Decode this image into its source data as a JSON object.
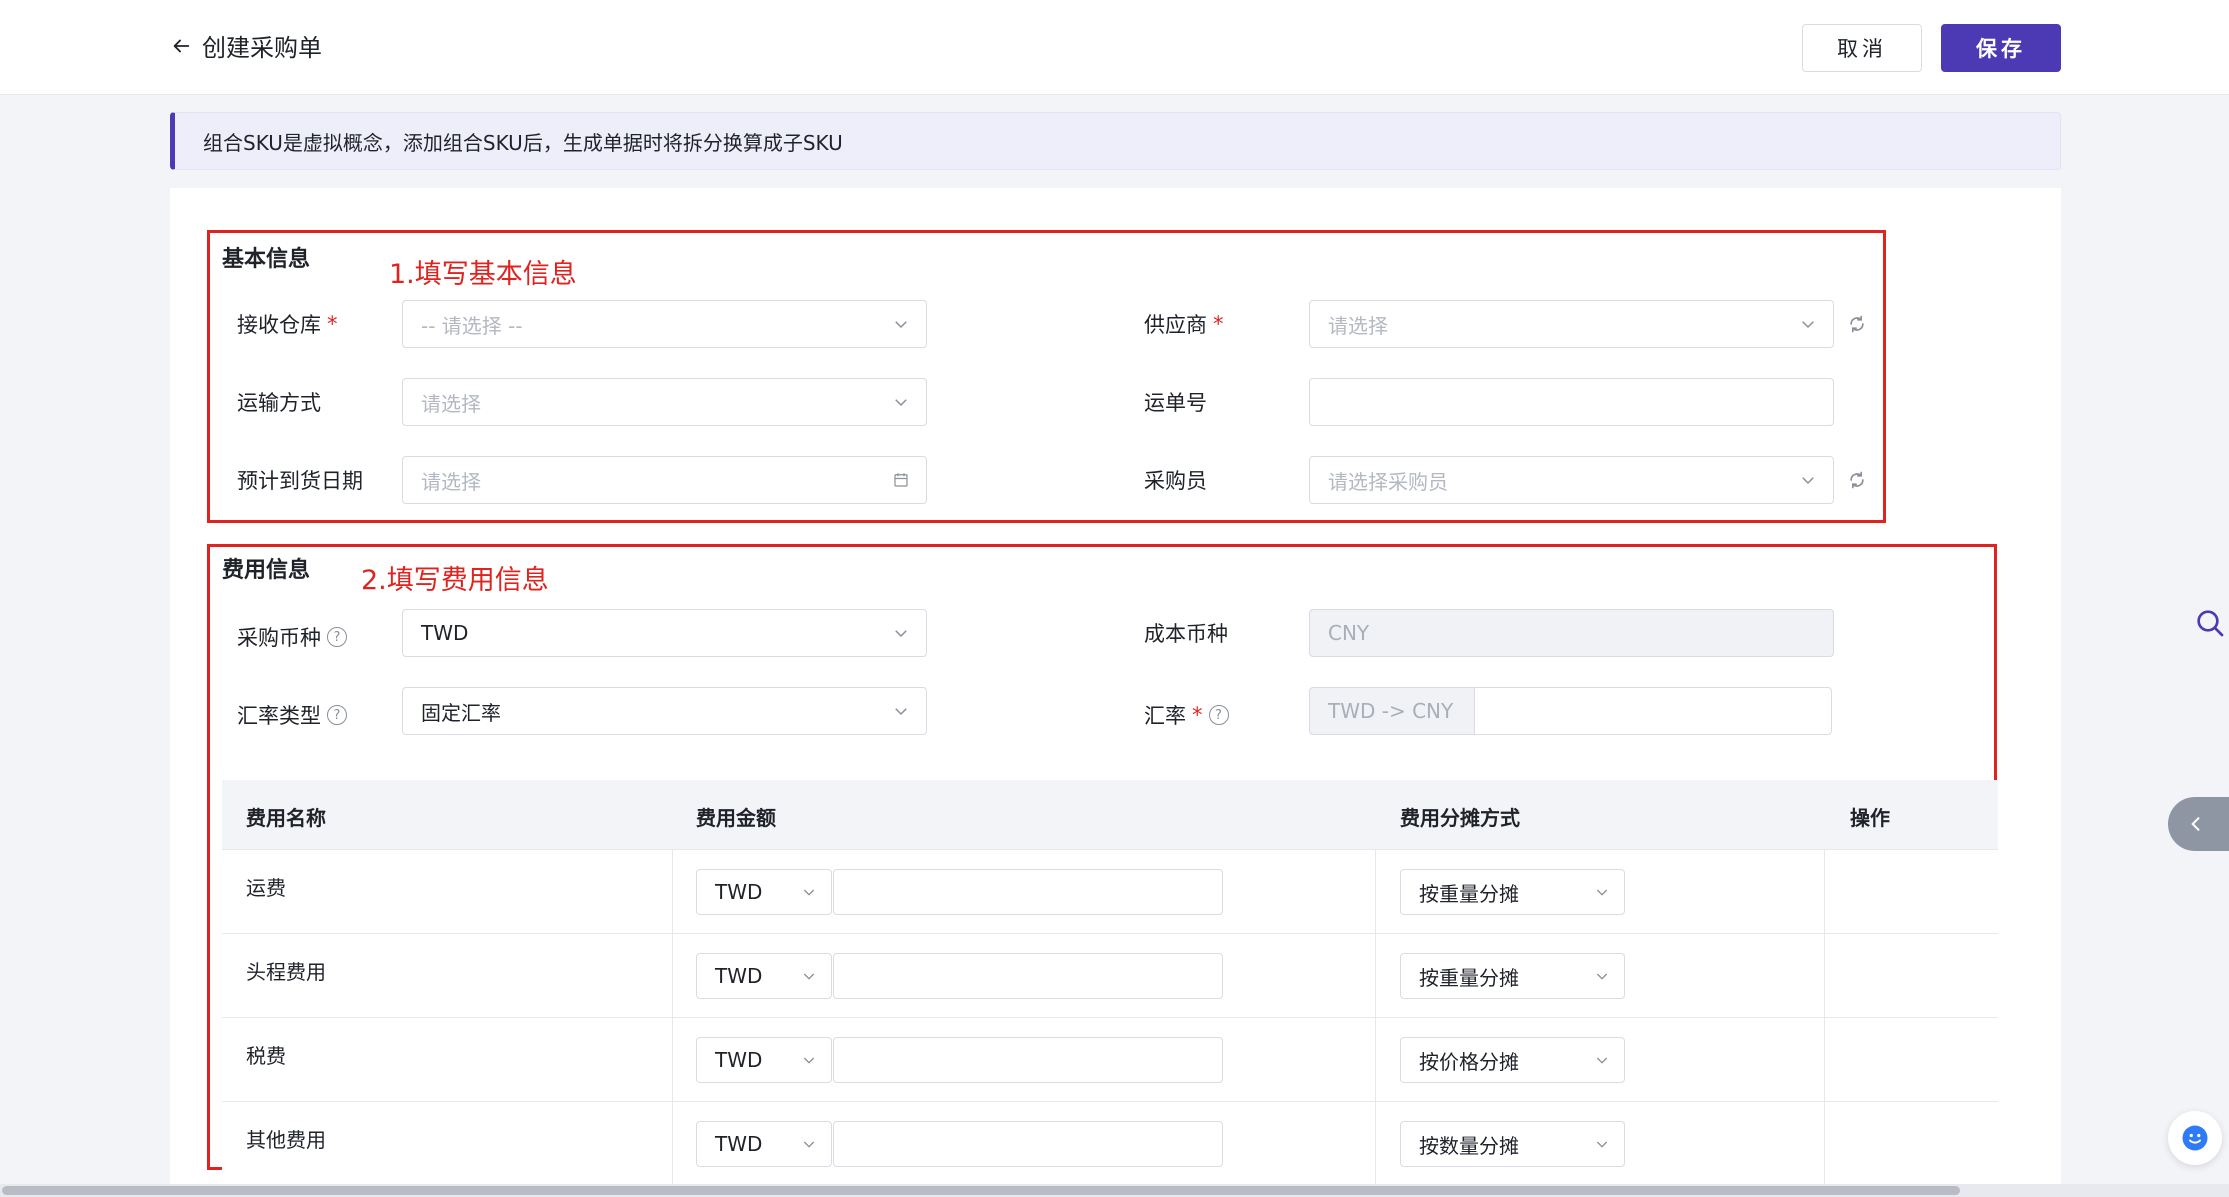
{
  "header": {
    "title": "创建采购单",
    "cancel_label": "取消",
    "save_label": "保存"
  },
  "notice": "组合SKU是虚拟概念，添加组合SKU后，生成单据时将拆分换算成子SKU",
  "basic_info": {
    "section_title": "基本信息",
    "annotation": "1.填写基本信息",
    "warehouse": {
      "label": "接收仓库",
      "required": "*",
      "placeholder": "-- 请选择 --"
    },
    "supplier": {
      "label": "供应商",
      "required": "*",
      "placeholder": "请选择"
    },
    "shipping_method": {
      "label": "运输方式",
      "placeholder": "请选择"
    },
    "tracking_no": {
      "label": "运单号",
      "value": ""
    },
    "eta": {
      "label": "预计到货日期",
      "placeholder": "请选择"
    },
    "buyer": {
      "label": "采购员",
      "placeholder": "请选择采购员"
    }
  },
  "cost_info": {
    "section_title": "费用信息",
    "annotation": "2.填写费用信息",
    "purchase_currency": {
      "label": "采购币种",
      "value": "TWD"
    },
    "cost_currency": {
      "label": "成本币种",
      "value": "CNY"
    },
    "rate_type": {
      "label": "汇率类型",
      "value": "固定汇率"
    },
    "rate": {
      "label": "汇率",
      "required": "*",
      "prefix": "TWD -> CNY",
      "value": ""
    }
  },
  "fee_table": {
    "columns": [
      "费用名称",
      "费用金额",
      "费用分摊方式",
      "操作"
    ],
    "rows": [
      {
        "name": "运费",
        "currency": "TWD",
        "amount": "",
        "allocation": "按重量分摊"
      },
      {
        "name": "头程费用",
        "currency": "TWD",
        "amount": "",
        "allocation": "按重量分摊"
      },
      {
        "name": "税费",
        "currency": "TWD",
        "amount": "",
        "allocation": "按价格分摊"
      },
      {
        "name": "其他费用",
        "currency": "TWD",
        "amount": "",
        "allocation": "按数量分摊"
      }
    ]
  },
  "colors": {
    "primary": "#4b3ab3",
    "annotation_red": "#e1231f",
    "notice_bg": "#eeeefb"
  },
  "icons": [
    "arrow-left-icon",
    "chevron-down-icon",
    "refresh-icon",
    "calendar-icon",
    "help-icon",
    "search-icon",
    "chevron-left-icon",
    "assistant-icon"
  ]
}
